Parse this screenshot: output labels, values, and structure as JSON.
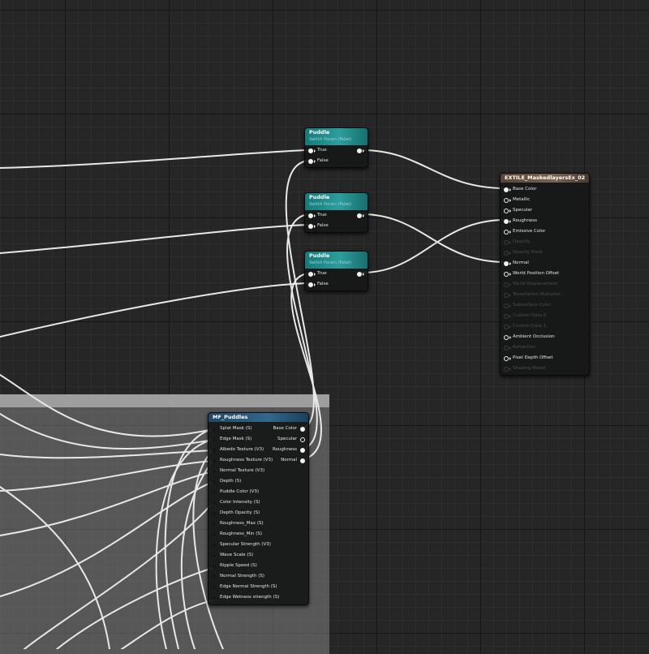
{
  "canvas": {
    "grid_color": "#262626",
    "wire_color": "#e8e8e8"
  },
  "comment_box": {
    "color": "#9e9e9e"
  },
  "puddle_nodes": [
    {
      "title": "Puddle",
      "subtitle": "Switch Param (False)",
      "inputs": [
        "True",
        "False"
      ]
    },
    {
      "title": "Puddle",
      "subtitle": "Switch Param (False)",
      "inputs": [
        "True",
        "False"
      ]
    },
    {
      "title": "Puddle",
      "subtitle": "Switch Param (False)",
      "inputs": [
        "True",
        "False"
      ]
    }
  ],
  "material_output": {
    "title": "EXTILE_MaskedlayersEx_02",
    "inputs": [
      {
        "label": "Base Color",
        "state": "connected"
      },
      {
        "label": "Metallic",
        "state": "active"
      },
      {
        "label": "Specular",
        "state": "active"
      },
      {
        "label": "Roughness",
        "state": "connected"
      },
      {
        "label": "Emissive Color",
        "state": "active"
      },
      {
        "label": "Opacity",
        "state": "disabled"
      },
      {
        "label": "Opacity Mask",
        "state": "disabled"
      },
      {
        "label": "Normal",
        "state": "connected"
      },
      {
        "label": "World Position Offset",
        "state": "active"
      },
      {
        "label": "World Displacement",
        "state": "disabled"
      },
      {
        "label": "Tessellation Multiplier",
        "state": "disabled"
      },
      {
        "label": "Subsurface Color",
        "state": "disabled"
      },
      {
        "label": "Custom Data 0",
        "state": "disabled"
      },
      {
        "label": "Custom Data 1",
        "state": "disabled"
      },
      {
        "label": "Ambient Occlusion",
        "state": "active"
      },
      {
        "label": "Refraction",
        "state": "disabled"
      },
      {
        "label": "Pixel Depth Offset",
        "state": "active"
      },
      {
        "label": "Shading Model",
        "state": "disabled"
      }
    ]
  },
  "mf_puddles": {
    "title": "MF_Puddles",
    "inputs": [
      "Splat Mask (S)",
      "Edge Mask (S)",
      "Albedo Texture (V3)",
      "Roughness Texture (V3)",
      "Normal Texture (V3)",
      "Depth (S)",
      "Puddle Color (V3)",
      "Color Intensity (S)",
      "Depth Opacity (S)",
      "Roughness_Max (S)",
      "Roughness_Min (S)",
      "Specular Strength (V3)",
      "Wave Scale (S)",
      "Ripple Speed (S)",
      "Normal Strength (S)",
      "Edge Normal Strength (S)",
      "Edge Wetness strength (S)"
    ],
    "outputs": [
      {
        "label": "Base Color",
        "connected": true
      },
      {
        "label": "Specular",
        "connected": false
      },
      {
        "label": "Roughness",
        "connected": true
      },
      {
        "label": "Normal",
        "connected": true
      }
    ]
  }
}
